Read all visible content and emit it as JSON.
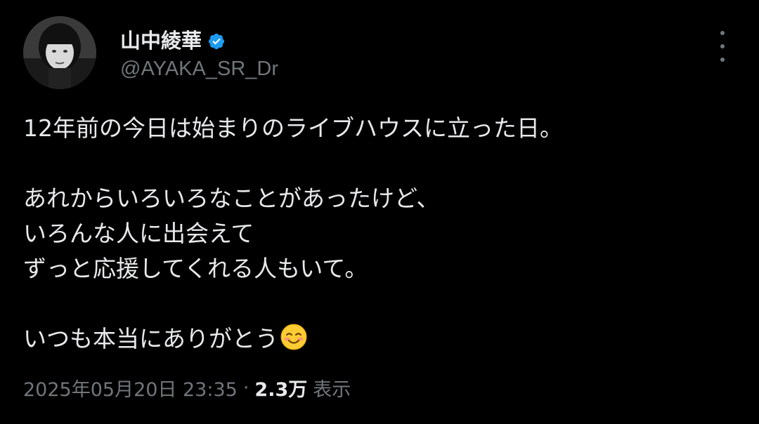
{
  "author": {
    "display_name": "山中綾華",
    "handle": "@AYAKA_SR_Dr",
    "verified": true,
    "verified_color": "#1d9bf0",
    "avatar_icon": "profile-photo"
  },
  "menu": {
    "icon": "more-vertical-icon"
  },
  "tweet": {
    "lines": [
      "12年前の今日は始まりのライブハウスに立った日。",
      "",
      "あれからいろいろなことがあったけど、",
      "いろんな人に出会えて",
      "ずっと応援してくれる人もいて。",
      "",
      "いつも本当にありがとう"
    ],
    "trailing_emoji": "☺️"
  },
  "meta": {
    "datetime": "2025年05月20日 23:35",
    "separator": "·",
    "views_count": "2.3万",
    "views_label": "表示"
  },
  "colors": {
    "background": "#000000",
    "primary_text": "#e7e9ea",
    "secondary_text": "#71767b"
  }
}
